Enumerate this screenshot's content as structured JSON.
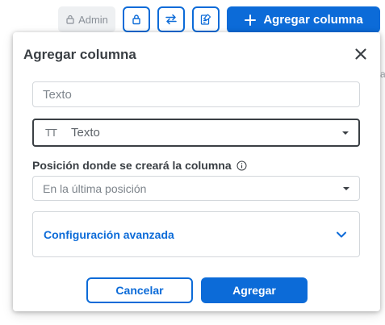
{
  "toolbar": {
    "admin_label": "Admin",
    "lock_icon": "lock-icon",
    "swap_icon": "swap-arrows-icon",
    "edit_icon": "edit-document-icon",
    "add_column_label": "Agregar columna"
  },
  "background": {
    "edge_text": "a"
  },
  "modal": {
    "title": "Agregar columna",
    "text_placeholder": "Texto",
    "type_icon_label": "TT",
    "type_value": "Texto",
    "position_label": "Posición donde se creará la columna",
    "position_value": "En la última posición",
    "advanced_label": "Configuración avanzada",
    "cancel_label": "Cancelar",
    "submit_label": "Agregar"
  },
  "colors": {
    "accent": "#0c6bd8",
    "text_dark": "#3a3f44",
    "border": "#d3d7db"
  }
}
